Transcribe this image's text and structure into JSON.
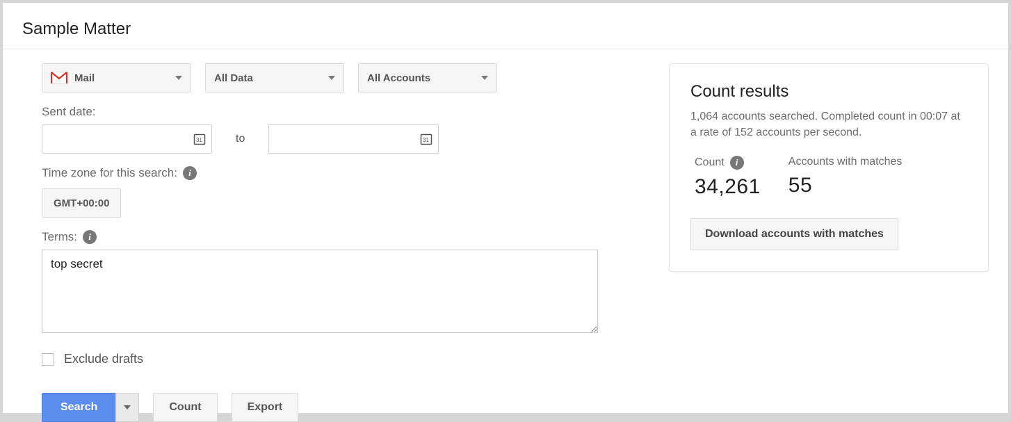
{
  "title": "Sample Matter",
  "filters": {
    "service_label": "Mail",
    "data_scope_label": "All Data",
    "accounts_label": "All Accounts"
  },
  "sent_date": {
    "label": "Sent date:",
    "from_value": "",
    "to_value": "",
    "to_word": "to"
  },
  "timezone": {
    "label": "Time zone for this search:",
    "value": "GMT+00:00"
  },
  "terms": {
    "label": "Terms:",
    "value": "top secret"
  },
  "exclude_drafts": {
    "label": "Exclude drafts",
    "checked": false
  },
  "actions": {
    "search": "Search",
    "count": "Count",
    "export": "Export"
  },
  "results": {
    "title": "Count results",
    "summary": "1,064 accounts searched. Completed count in 00:07 at a rate of 152 accounts per second.",
    "count_label": "Count",
    "count_value": "34,261",
    "accounts_label": "Accounts with matches",
    "accounts_value": "55",
    "download_label": "Download accounts with matches"
  }
}
